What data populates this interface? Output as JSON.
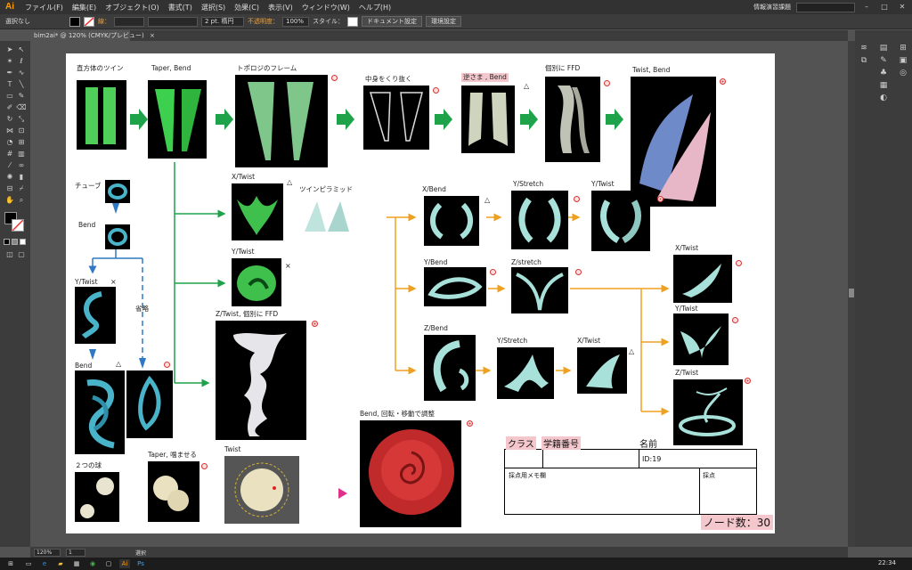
{
  "menubar": {
    "app_logo": "Ai",
    "items": [
      "ファイル(F)",
      "編集(E)",
      "オブジェクト(O)",
      "書式(T)",
      "選択(S)",
      "効果(C)",
      "表示(V)",
      "ウィンドウ(W)",
      "ヘルプ(H)"
    ],
    "workspace": "情報演習課題",
    "window_controls": [
      "–",
      "□",
      "✕"
    ]
  },
  "controlbar": {
    "selection": "選択なし",
    "stroke_label": "線：",
    "brush": "2 pt. 楕円",
    "opacity_label": "不透明度：",
    "opacity_value": "100%",
    "style_label": "スタイル：",
    "doc_settings": "ドキュメント設定",
    "prefs": "環境設定",
    "colors": {
      "accent_orange": "#ff9a00",
      "opacity_label": "#e8a040"
    }
  },
  "document_tab": {
    "title": "bim2ai* @ 120% (CMYK/プレビュー)",
    "close": "×"
  },
  "statusbar": {
    "zoom": "120%",
    "page": "1",
    "tool": "選択"
  },
  "taskbar": {
    "clock": "22:34"
  },
  "artboard": {
    "labels": {
      "cuboid": "直方体のツイン",
      "taper_bend": "Taper, Bend",
      "topology_frame": "トポロジのフレーム",
      "hollow": "中身をくり抜く",
      "reverse_bend": "逆さま , Bend",
      "individual_ffd": "個別に FFD",
      "twist_bend": "Twist, Bend",
      "tube": "チューブ",
      "bend": "Bend",
      "y_twist_left": "Y/Twist",
      "omit": "省略",
      "bend2": "Bend",
      "x_twist": "X/Twist",
      "y_twist_mid": "Y/Twist",
      "z_twist_ffd": "Z/Twist, 個別に FFD",
      "twin_pyramid": "ツインピラミッド",
      "x_bend": "X/Bend",
      "y_stretch_1": "Y/Stretch",
      "y_twist_r1": "Y/Twist",
      "y_bend": "Y/Bend",
      "z_stretch": "Z/stretch",
      "z_bend": "Z/Bend",
      "y_stretch_2": "Y/Stretch",
      "x_twist_2": "X/Twist",
      "x_twist_r": "X/Twist",
      "y_twist_r2": "Y/Twist",
      "z_twist_r": "Z/Twist",
      "rose": "Bend, 回転・移動で調整",
      "two_spheres": "２つの球",
      "taper_squash": "Taper, 噛ませる",
      "twist": "Twist"
    },
    "marks": {
      "circle": "○",
      "triangle": "△",
      "cross": "×",
      "double": "◎"
    },
    "grading": {
      "class": "クラス",
      "student_no": "学籍番号",
      "name": "名前",
      "id": "ID:19",
      "memo": "採点用メモ欄",
      "score": "採点",
      "node_count": "ノード数：30"
    },
    "arrow_colors": {
      "green": "#1fa34a",
      "blue": "#2f78c4",
      "orange": "#f0a020",
      "magenta": "#e0308a"
    }
  }
}
